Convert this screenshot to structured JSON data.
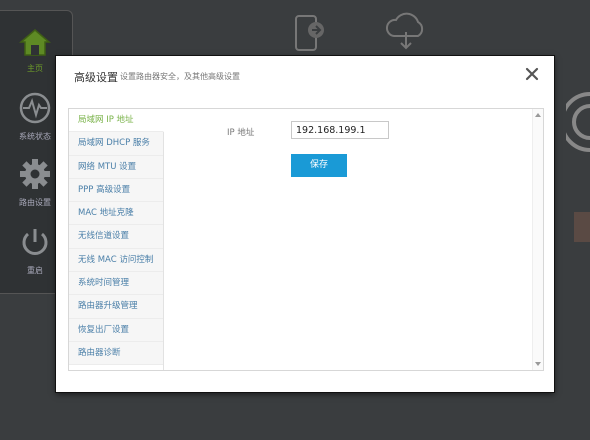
{
  "sidebar": {
    "items": [
      {
        "label": "主页",
        "icon": "home-icon"
      },
      {
        "label": "系统状态",
        "icon": "pulse-icon"
      },
      {
        "label": "路由设置",
        "icon": "gear-icon"
      },
      {
        "label": "重启",
        "icon": "power-icon"
      }
    ]
  },
  "bottom_mark": "",
  "modal": {
    "title": "高级设置",
    "subtitle": "设置路由器安全，及其他高级设置",
    "close_icon": "close-icon",
    "menu": [
      {
        "label": "局域网 IP 地址",
        "active": true
      },
      {
        "label": "局域网 DHCP 服务"
      },
      {
        "label": "网络 MTU 设置"
      },
      {
        "label": "PPP 高级设置"
      },
      {
        "label": "MAC 地址克隆"
      },
      {
        "label": "无线信道设置"
      },
      {
        "label": "无线 MAC 访问控制"
      },
      {
        "label": "系统时间管理"
      },
      {
        "label": "路由器升级管理"
      },
      {
        "label": "恢复出厂设置"
      },
      {
        "label": "路由器诊断"
      }
    ],
    "form": {
      "ip_label": "IP 地址",
      "ip_value": "192.168.199.1",
      "save_label": "保存"
    }
  },
  "colors": {
    "accent": "#1a9ad6",
    "active_menu": "#7ab34a",
    "menu_text": "#4a7fa8"
  }
}
